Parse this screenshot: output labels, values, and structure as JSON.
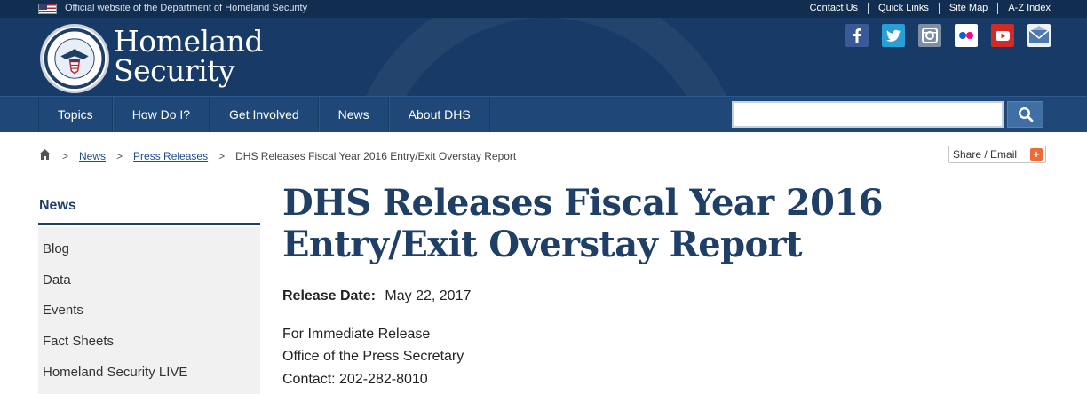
{
  "topbar": {
    "official_text": "Official website of the Department of Homeland Security",
    "links": [
      "Contact Us",
      "Quick Links",
      "Site Map",
      "A-Z Index"
    ]
  },
  "header": {
    "wordmark_line1": "Homeland",
    "wordmark_line2": "Security",
    "social_icons": [
      "facebook-icon",
      "twitter-icon",
      "instagram-icon",
      "flickr-icon",
      "youtube-icon",
      "email-icon"
    ]
  },
  "nav": {
    "items": [
      "Topics",
      "How Do I?",
      "Get Involved",
      "News",
      "About DHS"
    ],
    "search_value": ""
  },
  "breadcrumb": {
    "crumbs": [
      "News",
      "Press Releases"
    ],
    "current": "DHS Releases Fiscal Year 2016 Entry/Exit Overstay Report",
    "separator": ">"
  },
  "share": {
    "label": "Share / Email",
    "plus": "+"
  },
  "sidebar": {
    "title": "News",
    "items": [
      "Blog",
      "Data",
      "Events",
      "Fact Sheets",
      "Homeland Security LIVE"
    ]
  },
  "article": {
    "title": "DHS Releases Fiscal Year 2016 Entry/Exit Overstay Report",
    "release_label": "Release Date:",
    "release_date": "May 22, 2017",
    "lines": [
      "For Immediate Release",
      "Office of the Press Secretary",
      "Contact: 202-282-8010"
    ]
  },
  "colors": {
    "navy": "#112e51",
    "header_blue": "#183a66",
    "nav_blue": "#1f4878",
    "title_blue": "#1f3f66"
  }
}
